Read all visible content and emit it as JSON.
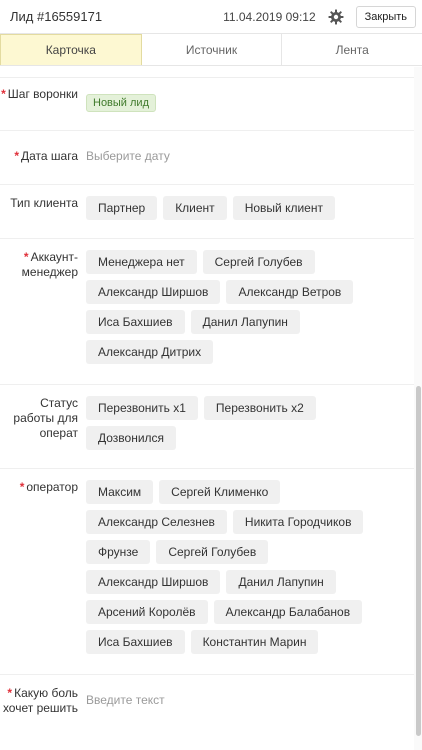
{
  "header": {
    "title": "Лид #16559171",
    "datetime": "11.04.2019 09:12",
    "close_label": "Закрыть",
    "settings_icon": "gear-icon"
  },
  "tabs": [
    {
      "label": "Карточка",
      "active": true
    },
    {
      "label": "Источник",
      "active": false
    },
    {
      "label": "Лента",
      "active": false
    }
  ],
  "fields": {
    "funnel_step": {
      "label": "Шаг воронки",
      "required": true,
      "value": "Новый лид"
    },
    "step_date": {
      "label": "Дата шага",
      "required": true,
      "placeholder": "Выберите дату"
    },
    "client_type": {
      "label": "Тип клиента",
      "required": false,
      "options": [
        "Партнер",
        "Клиент",
        "Новый клиент"
      ]
    },
    "account_manager": {
      "label": "Аккаунт-менеджер",
      "required": true,
      "options": [
        "Менеджера нет",
        "Сергей Голубев",
        "Александр Ширшов",
        "Александр Ветров",
        "Иса Бахшиев",
        "Данил Лапупин",
        "Александр Дитрих"
      ]
    },
    "operator_status": {
      "label": "Статус работы для операт",
      "required": false,
      "options": [
        "Перезвонить x1",
        "Перезвонить x2",
        "Дозвонился"
      ]
    },
    "operator": {
      "label": "оператор",
      "required": true,
      "options": [
        "Максим",
        "Сергей Клименко",
        "Александр Селезнев",
        "Никита Городчиков",
        "Фрунзе",
        "Сергей Голубев",
        "Александр Ширшов",
        "Данил Лапупин",
        "Арсений Королёв",
        "Александр Балабанов",
        "Иса Бахшиев",
        "Константин Марин"
      ]
    },
    "pain": {
      "label": "Какую боль хочет решить",
      "required": true,
      "placeholder": "Введите текст"
    }
  },
  "colors": {
    "accent_tab": "#fdf8d2",
    "required_star": "#e0303a",
    "badge_green": "#3f7a2b"
  }
}
